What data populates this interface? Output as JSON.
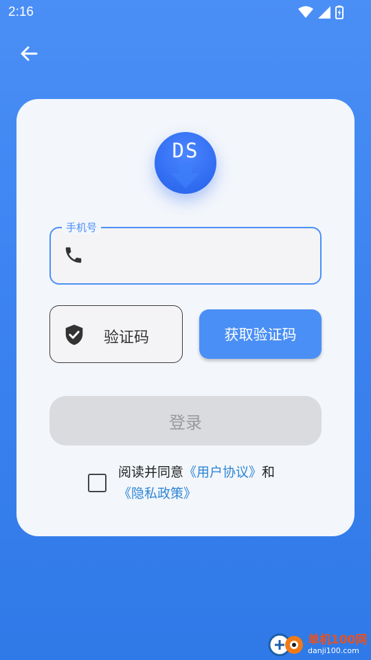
{
  "status_bar": {
    "time": "2:16"
  },
  "logo": {
    "text": "DS"
  },
  "phone": {
    "label": "手机号",
    "value": ""
  },
  "code": {
    "placeholder": "验证码"
  },
  "get_code": {
    "label": "获取验证码"
  },
  "login": {
    "label": "登录"
  },
  "agreement": {
    "prefix": "阅读并同意",
    "terms": "《用户协议》",
    "and": "和",
    "privacy": "《隐私政策》"
  },
  "watermark": {
    "title": "单机100网",
    "subtitle": "danji100.com"
  },
  "colors": {
    "accent": "#4a8ff5",
    "link": "#2f86d6",
    "logo": "#2f6bf0"
  }
}
